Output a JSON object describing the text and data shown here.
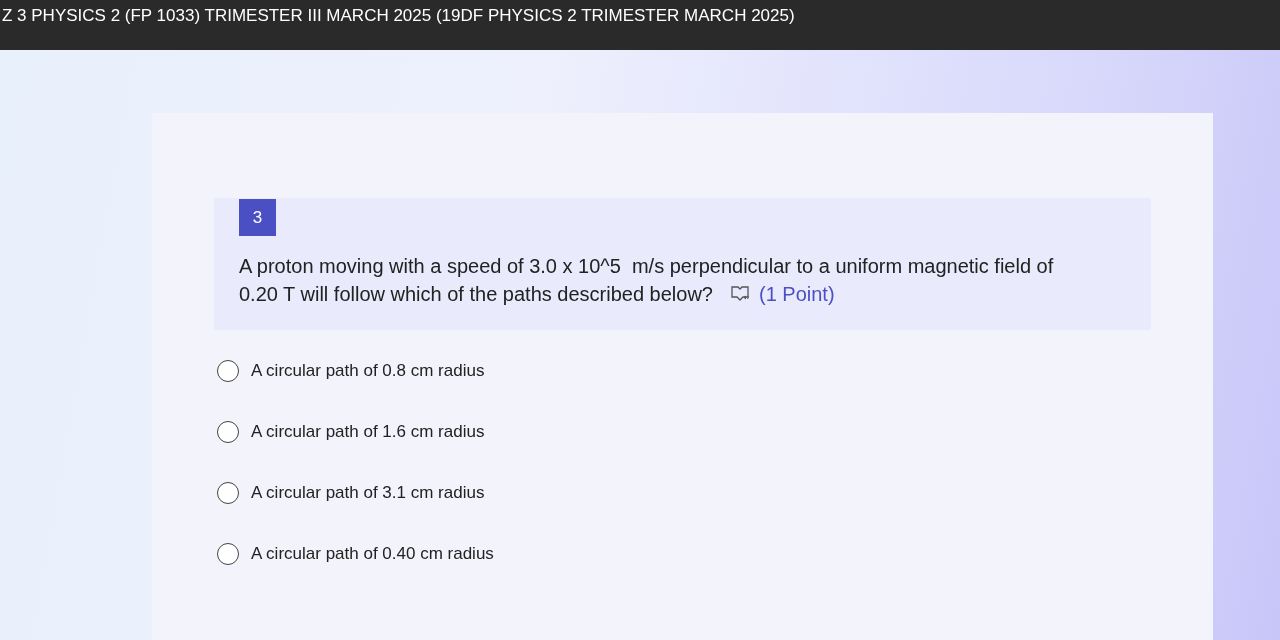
{
  "header": {
    "title": "Z 3 PHYSICS 2 (FP 1033) TRIMESTER III MARCH 2025 (19DF PHYSICS 2 TRIMESTER MARCH 2025)"
  },
  "question": {
    "number": "3",
    "text_lines": [
      "A proton moving with a speed of 3.0 x 10^5  m/s perpendicular to a uniform magnetic field of",
      "0.20 T will follow which of the paths described below?"
    ],
    "points": "(1 Point)"
  },
  "options": [
    {
      "label": "A circular path of 0.8 cm radius",
      "selected": false
    },
    {
      "label": "A circular path of 1.6 cm radius",
      "selected": false
    },
    {
      "label": "A circular path of 3.1 cm radius",
      "selected": false
    },
    {
      "label": "A circular path of 0.40 cm radius",
      "selected": false
    }
  ]
}
